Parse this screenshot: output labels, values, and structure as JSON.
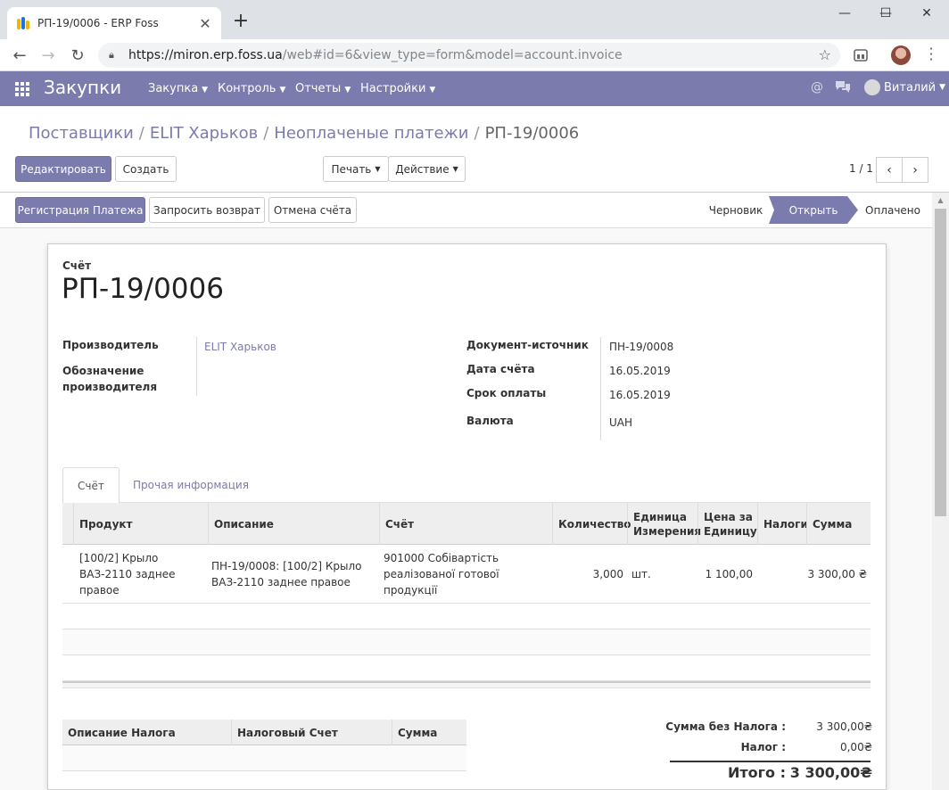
{
  "browser": {
    "tab_title": "РП-19/0006 - ERP Foss",
    "url_host": "https://miron.erp.foss.ua",
    "url_path": "/web#id=6&view_type=form&model=account.invoice",
    "new_tab": "+",
    "close_tab": "✕",
    "minimize": "—",
    "maximize": "☐",
    "close_window": "✕"
  },
  "nav": {
    "brand": "Закупки",
    "menus": [
      "Закупка",
      "Контроль",
      "Отчеты",
      "Настройки"
    ],
    "user": "Виталий"
  },
  "breadcrumb": {
    "items": [
      "Поставщики",
      "ELIT Харьков",
      "Неоплаченые платежи"
    ],
    "current": "РП-19/0006"
  },
  "actions": {
    "edit": "Редактировать",
    "create": "Создать",
    "print": "Печать",
    "action": "Действие",
    "pager": "1 / 1"
  },
  "statusbar": {
    "register_payment": "Регистрация Платежа",
    "request_refund": "Запросить возврат",
    "cancel_invoice": "Отмена счёта",
    "stages": [
      "Черновик",
      "Открыть",
      "Оплачено"
    ],
    "active_stage": "Открыть"
  },
  "invoice": {
    "type_label": "Счёт",
    "number": "РП-19/0006",
    "vendor_label": "Производитель",
    "vendor_value": "ELIT Харьков",
    "vendor_ref_label": "Обозначение производителя",
    "source_label": "Документ-источник",
    "source_value": "ПН-19/0008",
    "date_label": "Дата счёта",
    "date_value": "16.05.2019",
    "due_label": "Срок оплаты",
    "due_value": "16.05.2019",
    "currency_label": "Валюта",
    "currency_value": "UAH"
  },
  "tabs": [
    "Счёт",
    "Прочая информация"
  ],
  "lines": {
    "headers": [
      "Продукт",
      "Описание",
      "Счёт",
      "Количество",
      "Единица Измерения",
      "Цена за Единицу",
      "Налоги",
      "Сумма"
    ],
    "rows": [
      {
        "product": "[100/2] Крыло ВАЗ-2110 заднее правое",
        "description": "ПН-19/0008: [100/2] Крыло ВАЗ-2110 заднее правое",
        "account": "901000 Собівартість реалізованої готової продукції",
        "quantity": "3,000",
        "uom": "шт.",
        "price": "1 100,00",
        "taxes": "",
        "amount": "3 300,00 ₴"
      }
    ]
  },
  "tax_table": {
    "headers": [
      "Описание Налога",
      "Налоговый Счет",
      "Сумма"
    ]
  },
  "totals": {
    "untaxed_label": "Сумма без Налога :",
    "untaxed_value": "3 300,00₴",
    "tax_label": "Налог :",
    "tax_value": "0,00₴",
    "total_label": "Итого :",
    "total_value": "3 300,00₴"
  },
  "colors": {
    "brand": "#7c7bad"
  }
}
